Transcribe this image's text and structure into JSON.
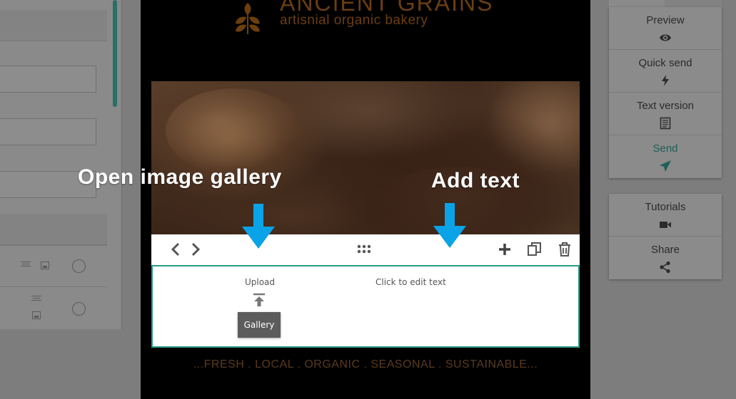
{
  "email": {
    "brand_title": "ANCIENT GRAINS",
    "brand_subtitle": "artisnial organic bakery",
    "tagline": "...FRESH . LOCAL . ORGANIC . SEASONAL . SUSTAINABLE...",
    "content_block": {
      "upload_label": "Upload",
      "gallery_button": "Gallery",
      "edit_text_placeholder": "Click to edit text"
    }
  },
  "annotations": {
    "open_gallery": "Open image gallery",
    "add_text": "Add text"
  },
  "right_panel": {
    "actions": [
      {
        "label": "Preview",
        "icon": "eye-icon"
      },
      {
        "label": "Quick send",
        "icon": "lightning-icon"
      },
      {
        "label": "Text version",
        "icon": "document-icon"
      },
      {
        "label": "Send",
        "icon": "paper-plane-icon"
      }
    ],
    "help": [
      {
        "label": "Tutorials",
        "icon": "video-camera-icon"
      },
      {
        "label": "Share",
        "icon": "share-icon"
      }
    ]
  },
  "colors": {
    "accent": "#2a9b89",
    "brand_brown": "#6b3e10",
    "arrow_blue": "#0aa3e8"
  }
}
